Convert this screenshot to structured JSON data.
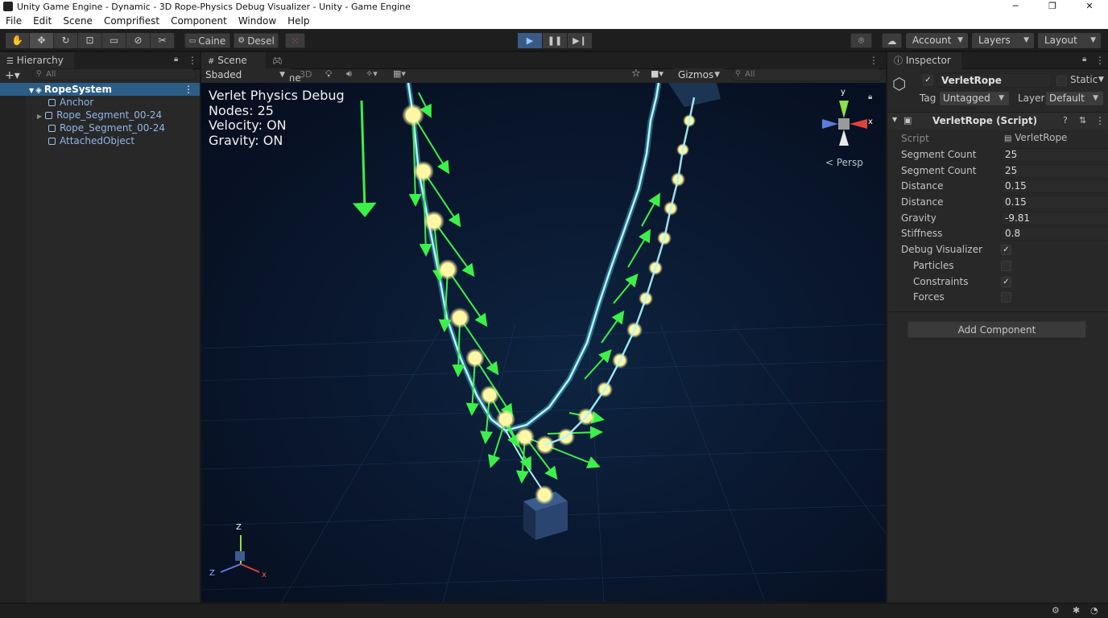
{
  "window": {
    "title": "Unity Game Engine - Dynamic - 3D Rope-Physics Debug Visualizer - Unity - Game Engine"
  },
  "menu": [
    "File",
    "Edit",
    "Scene",
    "Comprifiest",
    "Component",
    "Window",
    "Help"
  ],
  "toolbar": {
    "tools": [
      "hand-tool",
      "move-tool",
      "rotate-tool",
      "scale-tool",
      "rect-tool",
      "transform-tool",
      "custom-tool"
    ],
    "caine_label": "Caine",
    "desel_label": "Desel",
    "account_label": "Account",
    "layers_label": "Layers",
    "layout_label": "Layout"
  },
  "hierarchy": {
    "tab_label": "Hierarchy",
    "search_placeholder": "All",
    "items": [
      {
        "label": "RopeSystem"
      },
      {
        "label": "Anchor"
      },
      {
        "label": "Rope_Segment_00-24"
      },
      {
        "label": "Rope_Segment_00-24"
      },
      {
        "label": "AttachedObject"
      }
    ]
  },
  "scene": {
    "tab_scene": "Scene",
    "tab_game": "Game",
    "shading_mode": "Sbaded",
    "mode_3d": "3D",
    "gizmos_label": "Gizmos",
    "search_placeholder": "All",
    "persp_label": "< Persp",
    "overlay": {
      "title": "Verlet Physics Debug",
      "nodes": "Nodes: 25",
      "velocity": "Velocity: ON",
      "gravity": "Gravity: ON"
    },
    "axis": {
      "y": "y",
      "x": "x",
      "z": "Z"
    }
  },
  "inspector": {
    "tab_label": "Inspector",
    "object_name": "VerletRope",
    "static_label": "Static",
    "tag_label": "Tag",
    "tag_value": "Untagged",
    "layer_label": "Layer",
    "layer_value": "Default",
    "component_title": "VerletRope (Script)",
    "fields": [
      {
        "label": "Script",
        "value": "VerletRope"
      },
      {
        "label": "Segment Count",
        "value": "25"
      },
      {
        "label": "Segment Count",
        "value": "25"
      },
      {
        "label": "Distance",
        "value": "0.15"
      },
      {
        "label": "Distance",
        "value": "0.15"
      },
      {
        "label": "Gravity",
        "value": "-9.81"
      },
      {
        "label": "Stiffness",
        "value": "0.8"
      }
    ],
    "toggles": [
      {
        "label": "Debug Visualizer",
        "checked": true
      },
      {
        "label": "Particles",
        "checked": false
      },
      {
        "label": "Constraints",
        "checked": true
      },
      {
        "label": "Forces",
        "checked": false
      }
    ],
    "add_component_label": "Add Component"
  },
  "colors": {
    "rope": "#5fe6ff",
    "node": "#fff7a6",
    "arrow": "#3cf04a",
    "accent": "#2c5d87"
  }
}
